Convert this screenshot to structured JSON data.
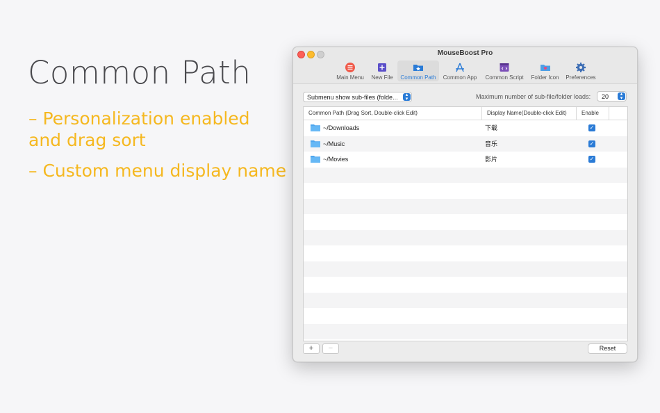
{
  "hero": {
    "title": "Common Path",
    "bullet1_line1": "– Personalization enabled",
    "bullet1_line2": "and drag sort",
    "bullet2": "– Custom menu display name"
  },
  "window": {
    "title": "MouseBoost Pro",
    "toolbar": [
      {
        "label": "Main Menu",
        "icon": "main-menu-icon"
      },
      {
        "label": "New File",
        "icon": "new-file-icon"
      },
      {
        "label": "Common Path",
        "icon": "common-path-icon",
        "active": true
      },
      {
        "label": "Common App",
        "icon": "common-app-icon"
      },
      {
        "label": "Common Script",
        "icon": "common-script-icon"
      },
      {
        "label": "Folder Icon",
        "icon": "folder-icon-icon"
      },
      {
        "label": "Preferences",
        "icon": "gear-icon"
      }
    ],
    "submenu_select": "Submenu show sub-files (folde...",
    "max_label": "Maximum number of sub-file/folder loads:",
    "max_value": "20",
    "columns": [
      "Common Path (Drag Sort, Double-click Edit)",
      "Display Name(Double-click Edit)",
      "Enable"
    ],
    "rows": [
      {
        "path": "~/Downloads",
        "name": "下载",
        "enabled": true
      },
      {
        "path": "~/Music",
        "name": "音乐",
        "enabled": true
      },
      {
        "path": "~/Movies",
        "name": "影片",
        "enabled": true
      }
    ],
    "add_label": "+",
    "remove_label": "−",
    "reset_label": "Reset"
  },
  "colors": {
    "accent": "#2a7bd6",
    "bullet_text": "#f5b820",
    "title_text": "#4a4a4e"
  }
}
